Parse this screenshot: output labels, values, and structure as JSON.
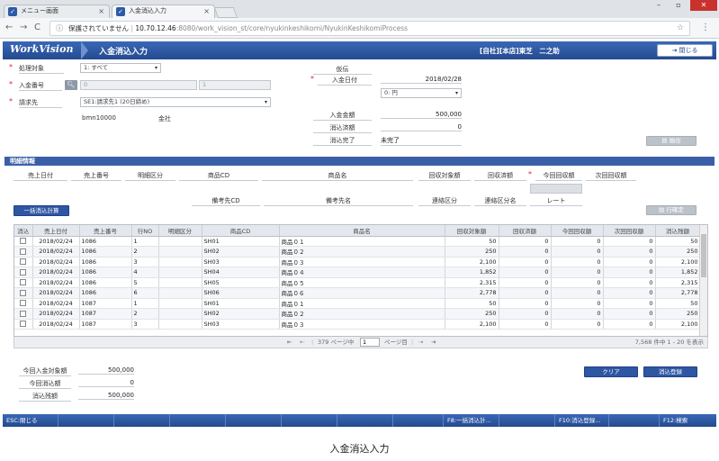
{
  "browser": {
    "tabs": [
      {
        "label": "メニュー画面",
        "active": false
      },
      {
        "label": "入金消込入力",
        "active": true
      }
    ],
    "security_label": "保護されていません",
    "url_host": "10.70.12.46",
    "url_path": ":8080/work_vision_st/core/nyukinkeshikomi/NyukinKeshikomiProcess"
  },
  "header": {
    "logo": "WorkVision",
    "title": "入金消込入力",
    "company": "[自社][本店]東芝　二之助",
    "close_label": "閉じる"
  },
  "form": {
    "shori_label": "処理対象",
    "shori_value": "1: すべて",
    "nyukin_no_label": "入金番号",
    "nyukin_no_value": "0",
    "nyukin_no_value2": "1",
    "seikyusaki_label": "請求先",
    "seikyusaki_value": "SE1:請求先1 (20日締め)",
    "customer_code": "bmn10000",
    "customer_name": "金社",
    "denpyo_label": "仮伝",
    "nyukin_date_label": "入金日付",
    "nyukin_date_value": "2018/02/28",
    "currency_value": "0: 円",
    "nyukin_amount_label": "入金金額",
    "nyukin_amount_value": "500,000",
    "keshikomi_amount_label": "消込済額",
    "keshikomi_amount_value": "0",
    "keshikomi_done_label": "消込完了",
    "keshikomi_done_value": "未完了",
    "extract_label": "抽出"
  },
  "detail": {
    "section_title": "明細情報",
    "headers_row1": [
      "売上日付",
      "売上番号",
      "明細区分",
      "商品CD",
      "商品名",
      "回収対象額",
      "回収済額",
      "今回回収額",
      "次回回収額"
    ],
    "headers_row2": [
      "備考先CD",
      "備考先名",
      "連絡区分",
      "連絡区分名",
      "レート"
    ],
    "bulk_calc_label": "一括消込計算",
    "row_confirm_label": "行確定"
  },
  "grid": {
    "columns": [
      "消込",
      "売上日付",
      "売上番号",
      "行NO",
      "明細区分",
      "商品CD",
      "商品名",
      "回収対象額",
      "回収済額",
      "今回回収額",
      "次回回収額",
      "消込残額"
    ],
    "rows": [
      [
        "2018/02/24",
        "1086",
        "1",
        "",
        "SH01",
        "商品０１",
        "50",
        "0",
        "0",
        "0",
        "50"
      ],
      [
        "2018/02/24",
        "1086",
        "2",
        "",
        "SH02",
        "商品０２",
        "250",
        "0",
        "0",
        "0",
        "250"
      ],
      [
        "2018/02/24",
        "1086",
        "3",
        "",
        "SH03",
        "商品０３",
        "2,100",
        "0",
        "0",
        "0",
        "2,100"
      ],
      [
        "2018/02/24",
        "1086",
        "4",
        "",
        "SH04",
        "商品０４",
        "1,852",
        "0",
        "0",
        "0",
        "1,852"
      ],
      [
        "2018/02/24",
        "1086",
        "5",
        "",
        "SH05",
        "商品０５",
        "2,315",
        "0",
        "0",
        "0",
        "2,315"
      ],
      [
        "2018/02/24",
        "1086",
        "6",
        "",
        "SH06",
        "商品０６",
        "2,778",
        "0",
        "0",
        "0",
        "2,778"
      ],
      [
        "2018/02/24",
        "1087",
        "1",
        "",
        "SH01",
        "商品０１",
        "50",
        "0",
        "0",
        "0",
        "50"
      ],
      [
        "2018/02/24",
        "1087",
        "2",
        "",
        "SH02",
        "商品０２",
        "250",
        "0",
        "0",
        "0",
        "250"
      ],
      [
        "2018/02/24",
        "1087",
        "3",
        "",
        "SH03",
        "商品０３",
        "2,100",
        "0",
        "0",
        "0",
        "2,100"
      ]
    ]
  },
  "pager": {
    "first": "⇤",
    "prev": "⇠",
    "pages_label": "379 ページ中",
    "page_value": "1",
    "page_suffix": "ページ目",
    "next": "⇢",
    "last": "⇥",
    "summary": "7,568 件中 1 - 20 を表示"
  },
  "totals": {
    "target_label": "今回入金対象額",
    "target_value": "500,000",
    "keshikomi_label": "今回消込額",
    "keshikomi_value": "0",
    "remaining_label": "消込残額",
    "remaining_value": "500,000",
    "clear_label": "クリア",
    "register_label": "消込登録"
  },
  "footer": {
    "esc": "ESC:閉じる",
    "f8": "F8:一括消込計...",
    "f10": "F10:消込登録...",
    "f12": "F12:検索"
  },
  "caption": "入金消込入力"
}
